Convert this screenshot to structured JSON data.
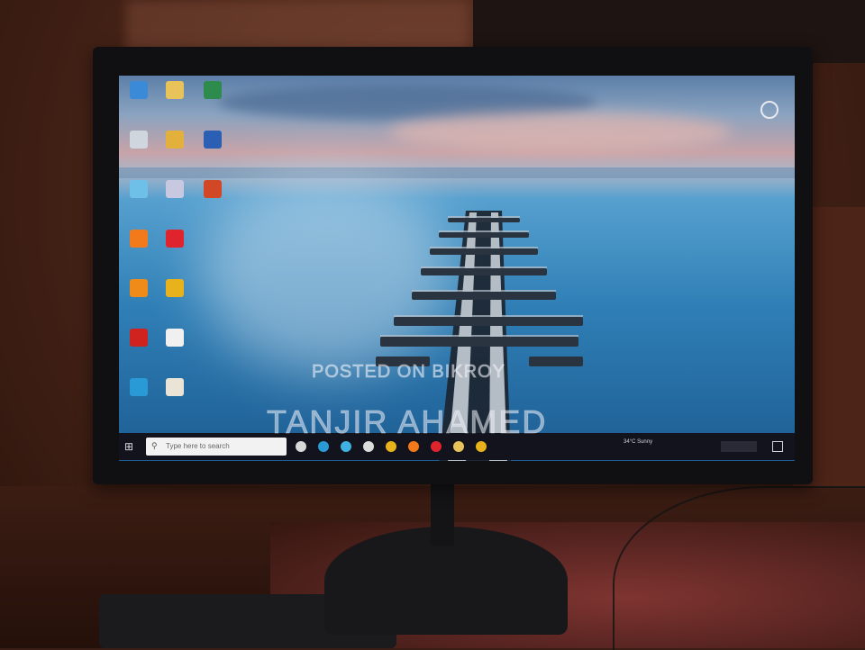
{
  "photo": {
    "subject": "desktop monitor showing Windows 10 desktop",
    "colors": {
      "wall": "#4a2518",
      "screen_sea": "#2f7fb6",
      "taskbar": "#13131d",
      "bezel": "#101012"
    }
  },
  "watermark": {
    "line1": "POSTED ON BIKROY",
    "line2": "TANJIR AHAMED"
  },
  "desktop": {
    "icons": [
      {
        "label": "",
        "icon": "computer-icon",
        "color": "#3a8ad8"
      },
      {
        "label": "",
        "icon": "folder-icon",
        "color": "#e8c35a"
      },
      {
        "label": "",
        "icon": "excel-icon",
        "color": "#2e8b4e"
      },
      {
        "label": "",
        "icon": "recycle-bin-icon",
        "color": "#cfd6de"
      },
      {
        "label": "",
        "icon": "control-panel-icon",
        "color": "#e3b03b"
      },
      {
        "label": "",
        "icon": "word-icon",
        "color": "#2b5fb3"
      },
      {
        "label": "",
        "icon": "app-icon",
        "color": "#6fc0e8"
      },
      {
        "label": "",
        "icon": "app-icon-2",
        "color": "#c8c8e0"
      },
      {
        "label": "",
        "icon": "powerpoint-icon",
        "color": "#d24726"
      },
      {
        "label": "",
        "icon": "firefox-icon",
        "color": "#f27a1a"
      },
      {
        "label": "",
        "icon": "opera-icon",
        "color": "#e0242e"
      },
      {
        "label": "",
        "icon": "vlc-icon",
        "color": "#f08b1a"
      },
      {
        "label": "",
        "icon": "chrome-icon",
        "color": "#e8b21c"
      },
      {
        "label": "",
        "icon": "acrobat-icon",
        "color": "#d0221e"
      },
      {
        "label": "",
        "icon": "text-file-icon",
        "color": "#f0f0f0"
      },
      {
        "label": "",
        "icon": "edge-icon",
        "color": "#2a9ad6"
      },
      {
        "label": "",
        "icon": "file-icon",
        "color": "#e9e4d6"
      }
    ],
    "corner_icon": "steam-icon"
  },
  "taskbar": {
    "start_icon": "windows-start-icon",
    "search_placeholder": "Type here to search",
    "pinned": [
      {
        "icon": "task-view-icon",
        "color": "#d8d8d8"
      },
      {
        "icon": "edge-taskbar-icon",
        "color": "#2a9ad6"
      },
      {
        "icon": "edge-taskbar-icon-2",
        "color": "#3fb0e0"
      },
      {
        "icon": "store-taskbar-icon",
        "color": "#dcdcdc"
      },
      {
        "icon": "chrome-taskbar-icon",
        "color": "#e8b21c"
      },
      {
        "icon": "firefox-taskbar-icon",
        "color": "#f27a1a"
      },
      {
        "icon": "opera-taskbar-icon",
        "color": "#e0242e"
      },
      {
        "icon": "explorer-taskbar-icon",
        "color": "#e8c35a"
      },
      {
        "icon": "chrome-taskbar-icon-2",
        "color": "#e8b21c"
      }
    ],
    "weather": "34°C Sunny"
  }
}
